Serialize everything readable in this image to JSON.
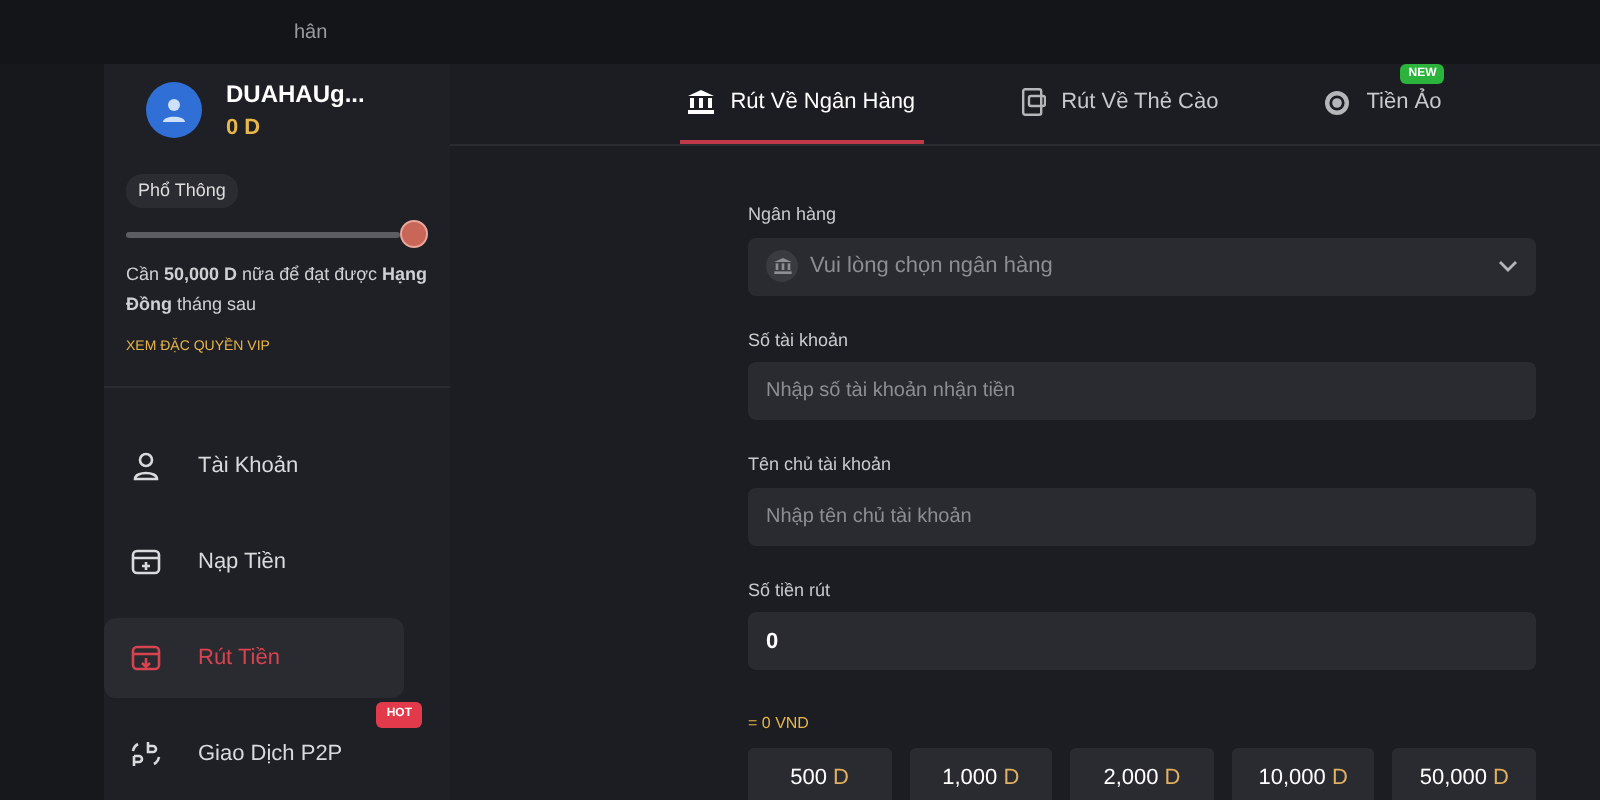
{
  "top_bar": {
    "breadcrumb": "hân"
  },
  "profile": {
    "username": "DUAHAUg...",
    "balance": "0 D",
    "tier": "Phổ Thông",
    "message": "Cần **50,000 D** nữa để đạt được **Hạng Đồng** tháng sau",
    "link": "XEM ĐẶC QUYỀN VIP"
  },
  "sidebar": {
    "items": [
      {
        "label": "Tài Khoản",
        "selected": false
      },
      {
        "label": "Nạp Tiền",
        "selected": false
      },
      {
        "label": "Rút Tiền",
        "selected": true
      },
      {
        "label": "Giao Dịch P2P",
        "selected": false,
        "badge": "HOT"
      }
    ]
  },
  "tabs": [
    {
      "label": "Rút Về Ngân Hàng",
      "selected": true
    },
    {
      "label": "Rút Về Thẻ Cào",
      "selected": false
    },
    {
      "label": "Tiền Ảo",
      "selected": false,
      "badge": "NEW"
    }
  ],
  "form": {
    "fields": [
      {
        "kind": "select",
        "label": "Ngân hàng",
        "placeholder": "Vui lòng chọn ngân hàng"
      },
      {
        "kind": "input",
        "label": "Số tài khoản",
        "placeholder": "Nhập số tài khoản nhận tiền"
      },
      {
        "kind": "input",
        "label": "Tên chủ tài khoản",
        "placeholder": "Nhập tên chủ tài khoản"
      },
      {
        "kind": "input",
        "label": "Số tiền rút",
        "value": "0"
      }
    ],
    "conversion": "= 0 VND",
    "quick_amounts": [
      {
        "amount": "500",
        "unit": "D"
      },
      {
        "amount": "1,000",
        "unit": "D"
      },
      {
        "amount": "2,000",
        "unit": "D"
      },
      {
        "amount": "10,000",
        "unit": "D"
      },
      {
        "amount": "50,000",
        "unit": "D"
      }
    ]
  }
}
